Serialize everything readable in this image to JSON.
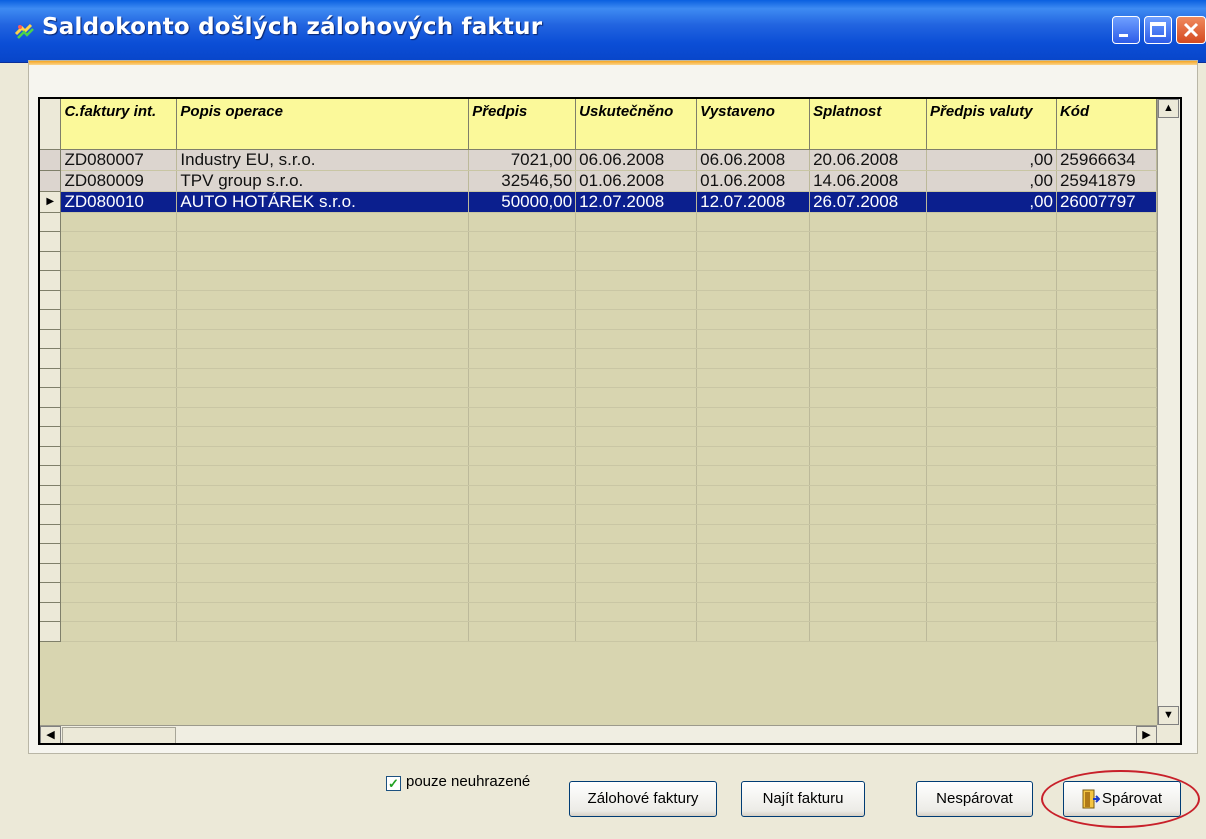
{
  "window": {
    "title": "Saldokonto došlých zálohových faktur",
    "icons": [
      "app-icon",
      "minimize-icon",
      "maximize-icon",
      "close-icon"
    ]
  },
  "grid": {
    "columns": [
      "C.faktury int.",
      "Popis operace",
      "Předpis",
      "Uskutečněno",
      "Vystaveno",
      "Splatnost",
      "Předpis valuty",
      "Kód"
    ],
    "rows": [
      {
        "c_faktury": "ZD080007",
        "popis": "Industry EU, s.r.o.",
        "predpis": "7021,00",
        "uskutecneno": "06.06.2008",
        "vystaveno": "06.06.2008",
        "splatnost": "20.06.2008",
        "predpis_valuty": ",00",
        "kod": "25966634"
      },
      {
        "c_faktury": "ZD080009",
        "popis": "TPV group s.r.o.",
        "predpis": "32546,50",
        "uskutecneno": "01.06.2008",
        "vystaveno": "01.06.2008",
        "splatnost": "14.06.2008",
        "predpis_valuty": ",00",
        "kod": "25941879"
      },
      {
        "c_faktury": "ZD080010",
        "popis": "AUTO HOTÁREK s.r.o.",
        "predpis": "50000,00",
        "uskutecneno": "12.07.2008",
        "vystaveno": "12.07.2008",
        "splatnost": "26.07.2008",
        "predpis_valuty": ",00",
        "kod": "26007797"
      }
    ],
    "selected_row": 3,
    "empty_rows": 22
  },
  "filter": {
    "label": "pouze neuhrazené",
    "checked": true
  },
  "buttons": {
    "zalohove": "Zálohové faktury",
    "najit": "Najít fakturu",
    "nesparovat": "Nespárovat",
    "sparovat": "Spárovat"
  },
  "colors": {
    "header": "#fbf99a",
    "row_selected": "#0b1f8e",
    "grid_bg": "#d8d5b0",
    "highlight_ring": "#c8202a"
  }
}
